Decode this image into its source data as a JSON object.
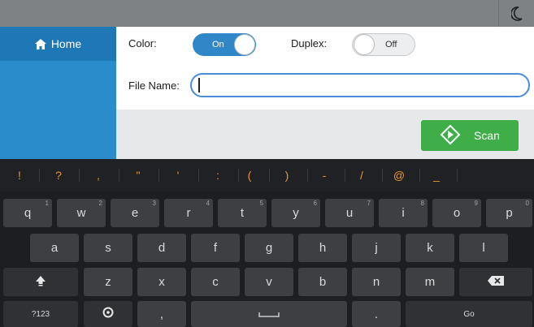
{
  "sidebar": {
    "home_label": "Home"
  },
  "form": {
    "color_label": "Color:",
    "color_toggle": "On",
    "duplex_label": "Duplex:",
    "duplex_toggle": "Off",
    "file_name_label": "File Name:",
    "file_name_value": ""
  },
  "scan_button": {
    "label": "Scan"
  },
  "keyboard": {
    "symbols": [
      "!",
      "?",
      ",",
      "\"",
      "'",
      ":",
      "(",
      ")",
      "-",
      "/",
      "@",
      "_"
    ],
    "row1": [
      {
        "key": "q",
        "hint": "1"
      },
      {
        "key": "w",
        "hint": "2"
      },
      {
        "key": "e",
        "hint": "3"
      },
      {
        "key": "r",
        "hint": "4"
      },
      {
        "key": "t",
        "hint": "5"
      },
      {
        "key": "y",
        "hint": "6"
      },
      {
        "key": "u",
        "hint": "7"
      },
      {
        "key": "i",
        "hint": "8"
      },
      {
        "key": "o",
        "hint": "9"
      },
      {
        "key": "p",
        "hint": "0"
      }
    ],
    "row2": [
      "a",
      "s",
      "d",
      "f",
      "g",
      "h",
      "j",
      "k",
      "l"
    ],
    "row3": [
      "z",
      "x",
      "c",
      "v",
      "b",
      "n",
      "m"
    ],
    "row4": {
      "mode_key": "?123",
      "comma_key": ",",
      "period_key": ".",
      "go_key": "Go"
    }
  },
  "colors": {
    "accent_blue": "#2b8ccc",
    "toggle_on": "#2f87c8",
    "scan_green": "#3fae49",
    "symbol_orange": "#e79a2b"
  },
  "icons": [
    "moon-icon",
    "home-icon",
    "scan-icon",
    "shift-icon",
    "backspace-icon",
    "settings-icon",
    "space-icon"
  ]
}
